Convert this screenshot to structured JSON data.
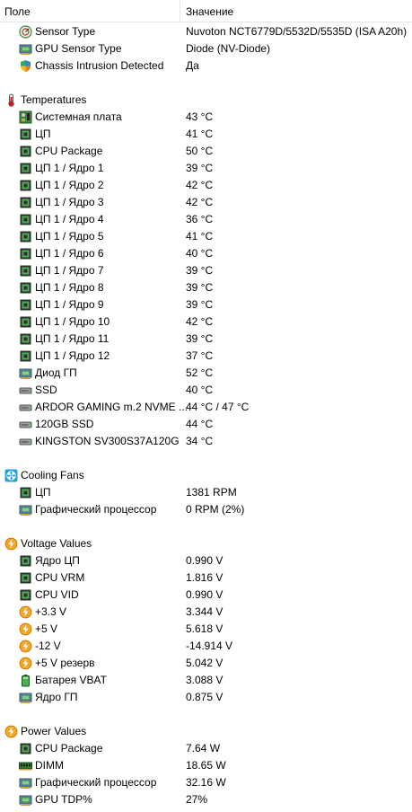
{
  "header": {
    "col_field": "Поле",
    "col_value": "Значение"
  },
  "rows": [
    {
      "type": "item",
      "icon": "sensor-icon",
      "label": "Sensor Type",
      "value": "Nuvoton NCT6779D/5532D/5535D  (ISA A20h)"
    },
    {
      "type": "item",
      "icon": "gpu-icon",
      "label": "GPU Sensor Type",
      "value": "Diode  (NV-Diode)"
    },
    {
      "type": "item",
      "icon": "shield-icon",
      "label": "Chassis Intrusion Detected",
      "value": "Да"
    },
    {
      "type": "gap"
    },
    {
      "type": "section",
      "icon": "thermometer-icon",
      "label": "Temperatures"
    },
    {
      "type": "item",
      "icon": "motherboard-icon",
      "label": "Системная плата",
      "value": "43 °C"
    },
    {
      "type": "item",
      "icon": "chip-icon",
      "label": "ЦП",
      "value": "41 °C"
    },
    {
      "type": "item",
      "icon": "chip-icon",
      "label": "CPU Package",
      "value": "50 °C"
    },
    {
      "type": "item",
      "icon": "chip-icon",
      "label": "ЦП 1 / Ядро 1",
      "value": "39 °C"
    },
    {
      "type": "item",
      "icon": "chip-icon",
      "label": "ЦП 1 / Ядро 2",
      "value": "42 °C"
    },
    {
      "type": "item",
      "icon": "chip-icon",
      "label": "ЦП 1 / Ядро 3",
      "value": "42 °C"
    },
    {
      "type": "item",
      "icon": "chip-icon",
      "label": "ЦП 1 / Ядро 4",
      "value": "36 °C"
    },
    {
      "type": "item",
      "icon": "chip-icon",
      "label": "ЦП 1 / Ядро 5",
      "value": "41 °C"
    },
    {
      "type": "item",
      "icon": "chip-icon",
      "label": "ЦП 1 / Ядро 6",
      "value": "40 °C"
    },
    {
      "type": "item",
      "icon": "chip-icon",
      "label": "ЦП 1 / Ядро 7",
      "value": "39 °C"
    },
    {
      "type": "item",
      "icon": "chip-icon",
      "label": "ЦП 1 / Ядро 8",
      "value": "39 °C"
    },
    {
      "type": "item",
      "icon": "chip-icon",
      "label": "ЦП 1 / Ядро 9",
      "value": "39 °C"
    },
    {
      "type": "item",
      "icon": "chip-icon",
      "label": "ЦП 1 / Ядро 10",
      "value": "42 °C"
    },
    {
      "type": "item",
      "icon": "chip-icon",
      "label": "ЦП 1 / Ядро 11",
      "value": "39 °C"
    },
    {
      "type": "item",
      "icon": "chip-icon",
      "label": "ЦП 1 / Ядро 12",
      "value": "37 °C"
    },
    {
      "type": "item",
      "icon": "gpu-icon",
      "label": "Диод ГП",
      "value": "52 °C"
    },
    {
      "type": "item",
      "icon": "disk-icon",
      "label": "SSD",
      "value": "40 °C"
    },
    {
      "type": "item",
      "icon": "disk-icon",
      "label": "ARDOR GAMING m.2 NVME ...",
      "value": "44 °C / 47 °C"
    },
    {
      "type": "item",
      "icon": "disk-icon",
      "label": "120GB SSD",
      "value": "44 °C"
    },
    {
      "type": "item",
      "icon": "disk-icon",
      "label": "KINGSTON SV300S37A120G",
      "value": "34 °C"
    },
    {
      "type": "gap"
    },
    {
      "type": "section",
      "icon": "fan-icon",
      "label": "Cooling Fans"
    },
    {
      "type": "item",
      "icon": "chip-icon",
      "label": "ЦП",
      "value": "1381 RPM"
    },
    {
      "type": "item",
      "icon": "gpu-icon",
      "label": "Графический процессор",
      "value": "0 RPM  (2%)"
    },
    {
      "type": "gap"
    },
    {
      "type": "section",
      "icon": "lightning-icon",
      "label": "Voltage Values"
    },
    {
      "type": "item",
      "icon": "chip-icon",
      "label": "Ядро ЦП",
      "value": "0.990 V"
    },
    {
      "type": "item",
      "icon": "chip-icon",
      "label": "CPU VRM",
      "value": "1.816 V"
    },
    {
      "type": "item",
      "icon": "chip-icon",
      "label": "CPU VID",
      "value": "0.990 V"
    },
    {
      "type": "item",
      "icon": "lightning-icon",
      "label": "+3.3 V",
      "value": "3.344 V"
    },
    {
      "type": "item",
      "icon": "lightning-icon",
      "label": "+5 V",
      "value": "5.618 V"
    },
    {
      "type": "item",
      "icon": "lightning-icon",
      "label": "-12 V",
      "value": "-14.914 V"
    },
    {
      "type": "item",
      "icon": "lightning-icon",
      "label": "+5 V резерв",
      "value": "5.042 V"
    },
    {
      "type": "item",
      "icon": "battery-icon",
      "label": "Батарея VBAT",
      "value": "3.088 V"
    },
    {
      "type": "item",
      "icon": "gpu-icon",
      "label": "Ядро ГП",
      "value": "0.875 V"
    },
    {
      "type": "gap"
    },
    {
      "type": "section",
      "icon": "lightning-icon",
      "label": "Power Values"
    },
    {
      "type": "item",
      "icon": "chip-icon",
      "label": "CPU Package",
      "value": "7.64 W"
    },
    {
      "type": "item",
      "icon": "memory-icon",
      "label": "DIMM",
      "value": "18.65 W"
    },
    {
      "type": "item",
      "icon": "gpu-icon",
      "label": "Графический процессор",
      "value": "32.16 W"
    },
    {
      "type": "item",
      "icon": "gpu-icon",
      "label": "GPU TDP%",
      "value": "27%"
    }
  ]
}
